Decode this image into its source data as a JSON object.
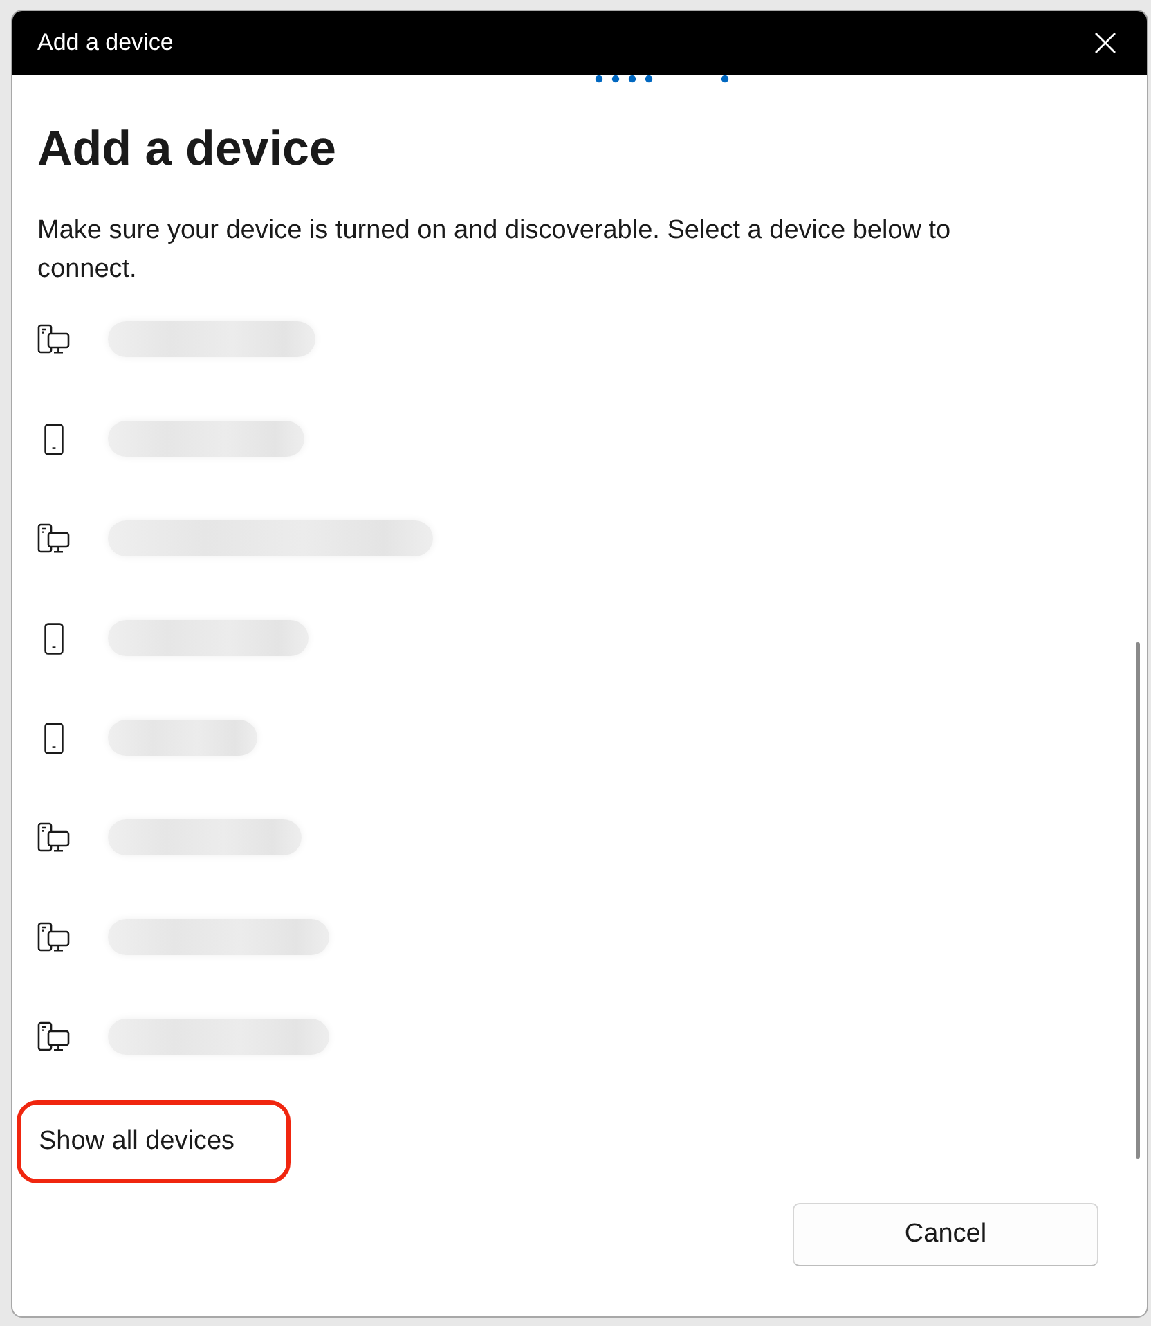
{
  "window": {
    "title": "Add a device"
  },
  "heading": "Add a device",
  "description": "Make sure your device is turned on and discoverable. Select a device below to connect.",
  "devices": [
    {
      "kind": "computer"
    },
    {
      "kind": "phone"
    },
    {
      "kind": "computer"
    },
    {
      "kind": "phone"
    },
    {
      "kind": "phone"
    },
    {
      "kind": "computer"
    },
    {
      "kind": "computer"
    },
    {
      "kind": "computer"
    }
  ],
  "show_all_link": {
    "label": "Show all devices",
    "highlighted": true
  },
  "buttons": [
    {
      "label": "Cancel"
    }
  ]
}
